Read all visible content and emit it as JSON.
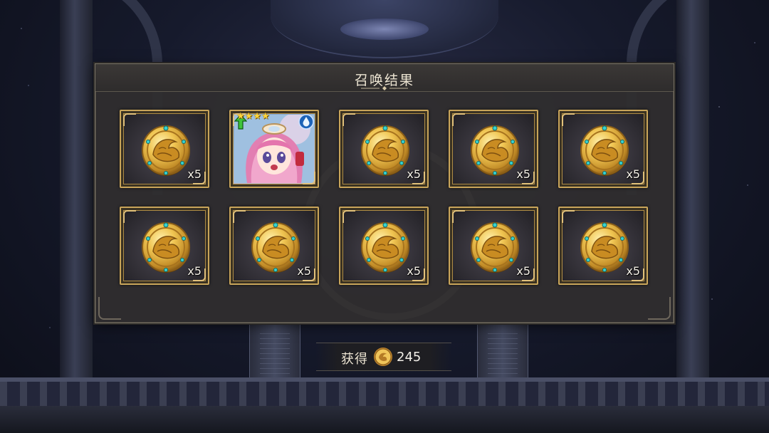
{
  "panel": {
    "title": "召唤结果"
  },
  "results": [
    {
      "kind": "coin",
      "qty": "x5"
    },
    {
      "kind": "character",
      "rarity": 4,
      "stars": "★★★★",
      "element_icon": "water-drop-icon",
      "badge_icon": "upgrade-arrow-icon"
    },
    {
      "kind": "coin",
      "qty": "x5"
    },
    {
      "kind": "coin",
      "qty": "x5"
    },
    {
      "kind": "coin",
      "qty": "x5"
    },
    {
      "kind": "coin",
      "qty": "x5"
    },
    {
      "kind": "coin",
      "qty": "x5"
    },
    {
      "kind": "coin",
      "qty": "x5"
    },
    {
      "kind": "coin",
      "qty": "x5"
    },
    {
      "kind": "coin",
      "qty": "x5"
    }
  ],
  "reward": {
    "label": "获得",
    "icon": "gold-coin-icon",
    "value": "245"
  },
  "colors": {
    "gold": "#c9a55a",
    "panel": "#302e2f",
    "text": "#ece4d2"
  }
}
